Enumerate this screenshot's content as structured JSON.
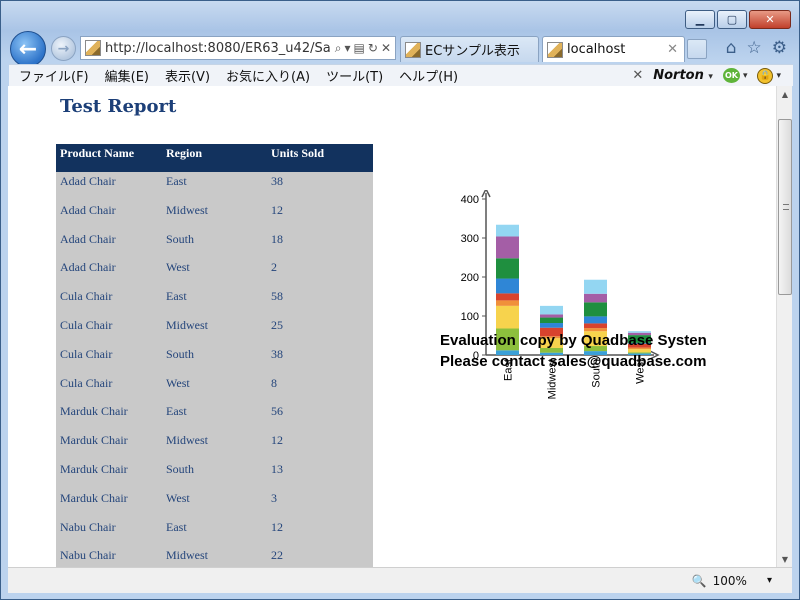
{
  "browser": {
    "address": "http://localhost:8080/ER63_u42/Sa",
    "tabs": [
      {
        "label": "ECサンプル表示"
      },
      {
        "label": "localhost"
      }
    ],
    "menu": [
      "ファイル(F)",
      "編集(E)",
      "表示(V)",
      "お気に入り(A)",
      "ツール(T)",
      "ヘルプ(H)"
    ],
    "norton_label": "Norton",
    "ok_label": "OK",
    "zoom": "100%"
  },
  "report": {
    "title": "Test Report",
    "columns": [
      "Product Name",
      "Region",
      "Units Sold"
    ],
    "rows": [
      [
        "Adad Chair",
        "East",
        "38"
      ],
      [
        "Adad Chair",
        "Midwest",
        "12"
      ],
      [
        "Adad Chair",
        "South",
        "18"
      ],
      [
        "Adad Chair",
        "West",
        "2"
      ],
      [
        "Cula Chair",
        "East",
        "58"
      ],
      [
        "Cula Chair",
        "Midwest",
        "25"
      ],
      [
        "Cula Chair",
        "South",
        "38"
      ],
      [
        "Cula Chair",
        "West",
        "8"
      ],
      [
        "Marduk Chair",
        "East",
        "56"
      ],
      [
        "Marduk Chair",
        "Midwest",
        "12"
      ],
      [
        "Marduk Chair",
        "South",
        "13"
      ],
      [
        "Marduk Chair",
        "West",
        "3"
      ],
      [
        "Nabu Chair",
        "East",
        "12"
      ],
      [
        "Nabu Chair",
        "Midwest",
        "22"
      ]
    ]
  },
  "chart_data": {
    "type": "bar",
    "stacked": true,
    "categories": [
      "East",
      "Midwest",
      "South",
      "West"
    ],
    "ylim": [
      0,
      400
    ],
    "yticks": [
      0,
      100,
      200,
      300,
      400
    ],
    "series": [
      {
        "color": "#3aa0d8",
        "values": [
          12,
          6,
          10,
          4
        ]
      },
      {
        "color": "#8dbf3d",
        "values": [
          56,
          12,
          13,
          3
        ]
      },
      {
        "color": "#f7d34d",
        "values": [
          58,
          25,
          38,
          8
        ]
      },
      {
        "color": "#f0903a",
        "values": [
          14,
          5,
          8,
          4
        ]
      },
      {
        "color": "#d8432e",
        "values": [
          18,
          22,
          12,
          10
        ]
      },
      {
        "color": "#2f86d6",
        "values": [
          38,
          12,
          18,
          2
        ]
      },
      {
        "color": "#1f8f3f",
        "values": [
          52,
          14,
          36,
          20
        ]
      },
      {
        "color": "#a45ea6",
        "values": [
          56,
          8,
          22,
          6
        ]
      },
      {
        "color": "#93d6f2",
        "values": [
          30,
          22,
          36,
          4
        ]
      }
    ],
    "watermark": [
      "Evaluation copy by Quadbase Systen",
      "Please contact sales@quadbase.com"
    ]
  }
}
